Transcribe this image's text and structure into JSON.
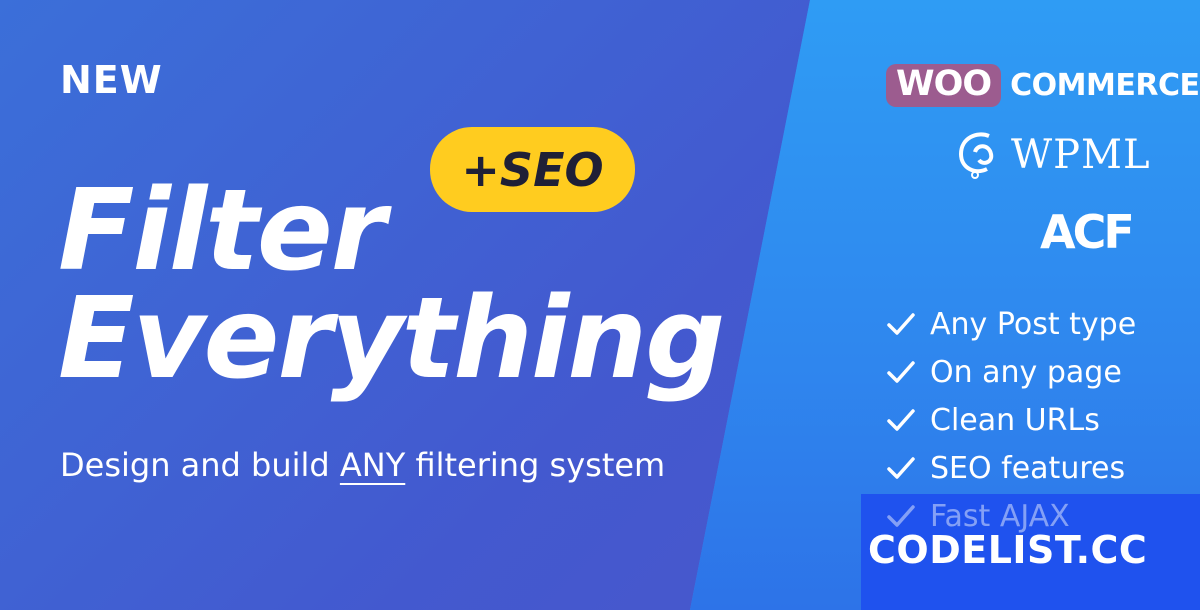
{
  "banner": {
    "new_label": "NEW",
    "seo_badge": "+SEO",
    "title_line1": "Filter",
    "title_line2": "Everything",
    "subtitle_before": "Design and build ",
    "subtitle_emphasis": "ANY",
    "subtitle_after": " filtering system"
  },
  "logos": {
    "woo_part": "WOO",
    "commerce_part": "COMMERCE",
    "wpml": "WPML",
    "acf": "ACF"
  },
  "features": [
    "Any Post type",
    "On any page",
    "Clean URLs",
    "SEO features",
    "Fast AJAX"
  ],
  "watermark": "CODELIST.CC",
  "colors": {
    "left_bg": "#4359cf",
    "right_bg": "#2f8cf0",
    "badge": "#ffcc1f",
    "woo": "#9c5c8f",
    "watermark_bg": "#1f52ee"
  }
}
